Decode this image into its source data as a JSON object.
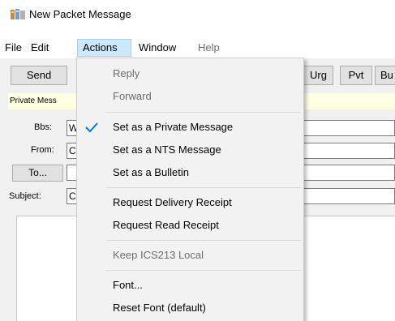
{
  "window": {
    "title": "New Packet Message"
  },
  "menubar": {
    "items": [
      {
        "label": "File",
        "state": "normal"
      },
      {
        "label": "Edit",
        "state": "normal"
      },
      {
        "label": "Actions",
        "state": "active"
      },
      {
        "label": "Window",
        "state": "normal"
      },
      {
        "label": "Help",
        "state": "disabled"
      }
    ]
  },
  "toolbar": {
    "send_label": "Send",
    "urg_label": "Urg",
    "pvt_label": "Pvt",
    "bu_label": "Bu"
  },
  "infobar": {
    "text": "Private Mess"
  },
  "form": {
    "bbs_label": "Bbs:",
    "bbs_value": "W",
    "from_label": "From:",
    "from_value": "C",
    "to_button": "To...",
    "to_value": "",
    "subject_label": "Subject:",
    "subject_value": "C"
  },
  "actions_menu": {
    "items": [
      {
        "label": "Reply",
        "enabled": false,
        "checked": false
      },
      {
        "label": "Forward",
        "enabled": false,
        "checked": false
      },
      {
        "label": "Set as a Private Message",
        "enabled": true,
        "checked": true
      },
      {
        "label": "Set as a NTS Message",
        "enabled": true,
        "checked": false
      },
      {
        "label": "Set as a Bulletin",
        "enabled": true,
        "checked": false
      },
      {
        "label": "Request Delivery Receipt",
        "enabled": true,
        "checked": false
      },
      {
        "label": "Request Read Receipt",
        "enabled": true,
        "checked": false
      },
      {
        "label": "Keep ICS213 Local",
        "enabled": false,
        "checked": false
      },
      {
        "label": "Font...",
        "enabled": true,
        "checked": false
      },
      {
        "label": "Reset Font (default)",
        "enabled": true,
        "checked": false
      }
    ]
  },
  "colors": {
    "menu_highlight": "#cce8ff",
    "check_color": "#0078d7",
    "infobar_bg": "#ffffe1"
  }
}
